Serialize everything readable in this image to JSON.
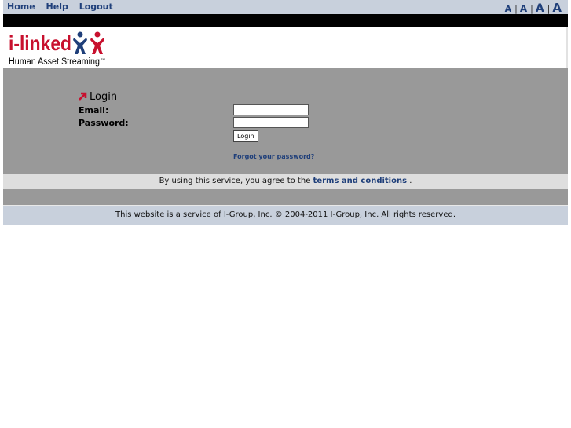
{
  "nav": {
    "home": "Home",
    "help": "Help",
    "logout": "Logout"
  },
  "font_sizes": {
    "small": "A",
    "medium": "A",
    "large": "A",
    "xlarge": "A",
    "separator": "|"
  },
  "logo": {
    "brand": "i-linked",
    "tagline": "Human Asset Streaming",
    "tm": "TM"
  },
  "login": {
    "title": "Login",
    "email_label": "Email:",
    "email_value": "",
    "password_label": "Password:",
    "password_value": "",
    "button": "Login",
    "forgot": "Forgot your password?"
  },
  "terms": {
    "prefix": "By using this service, you agree to the",
    "link": "terms and conditions",
    "suffix": "."
  },
  "footer": {
    "text": "This website is a service of I-Group, Inc. © 2004-2011 I-Group, Inc. All rights reserved."
  },
  "colors": {
    "brand_red": "#c8102e",
    "brand_blue": "#1f3f7a",
    "nav_bg": "#c8d0dc",
    "panel_gray": "#999999"
  }
}
